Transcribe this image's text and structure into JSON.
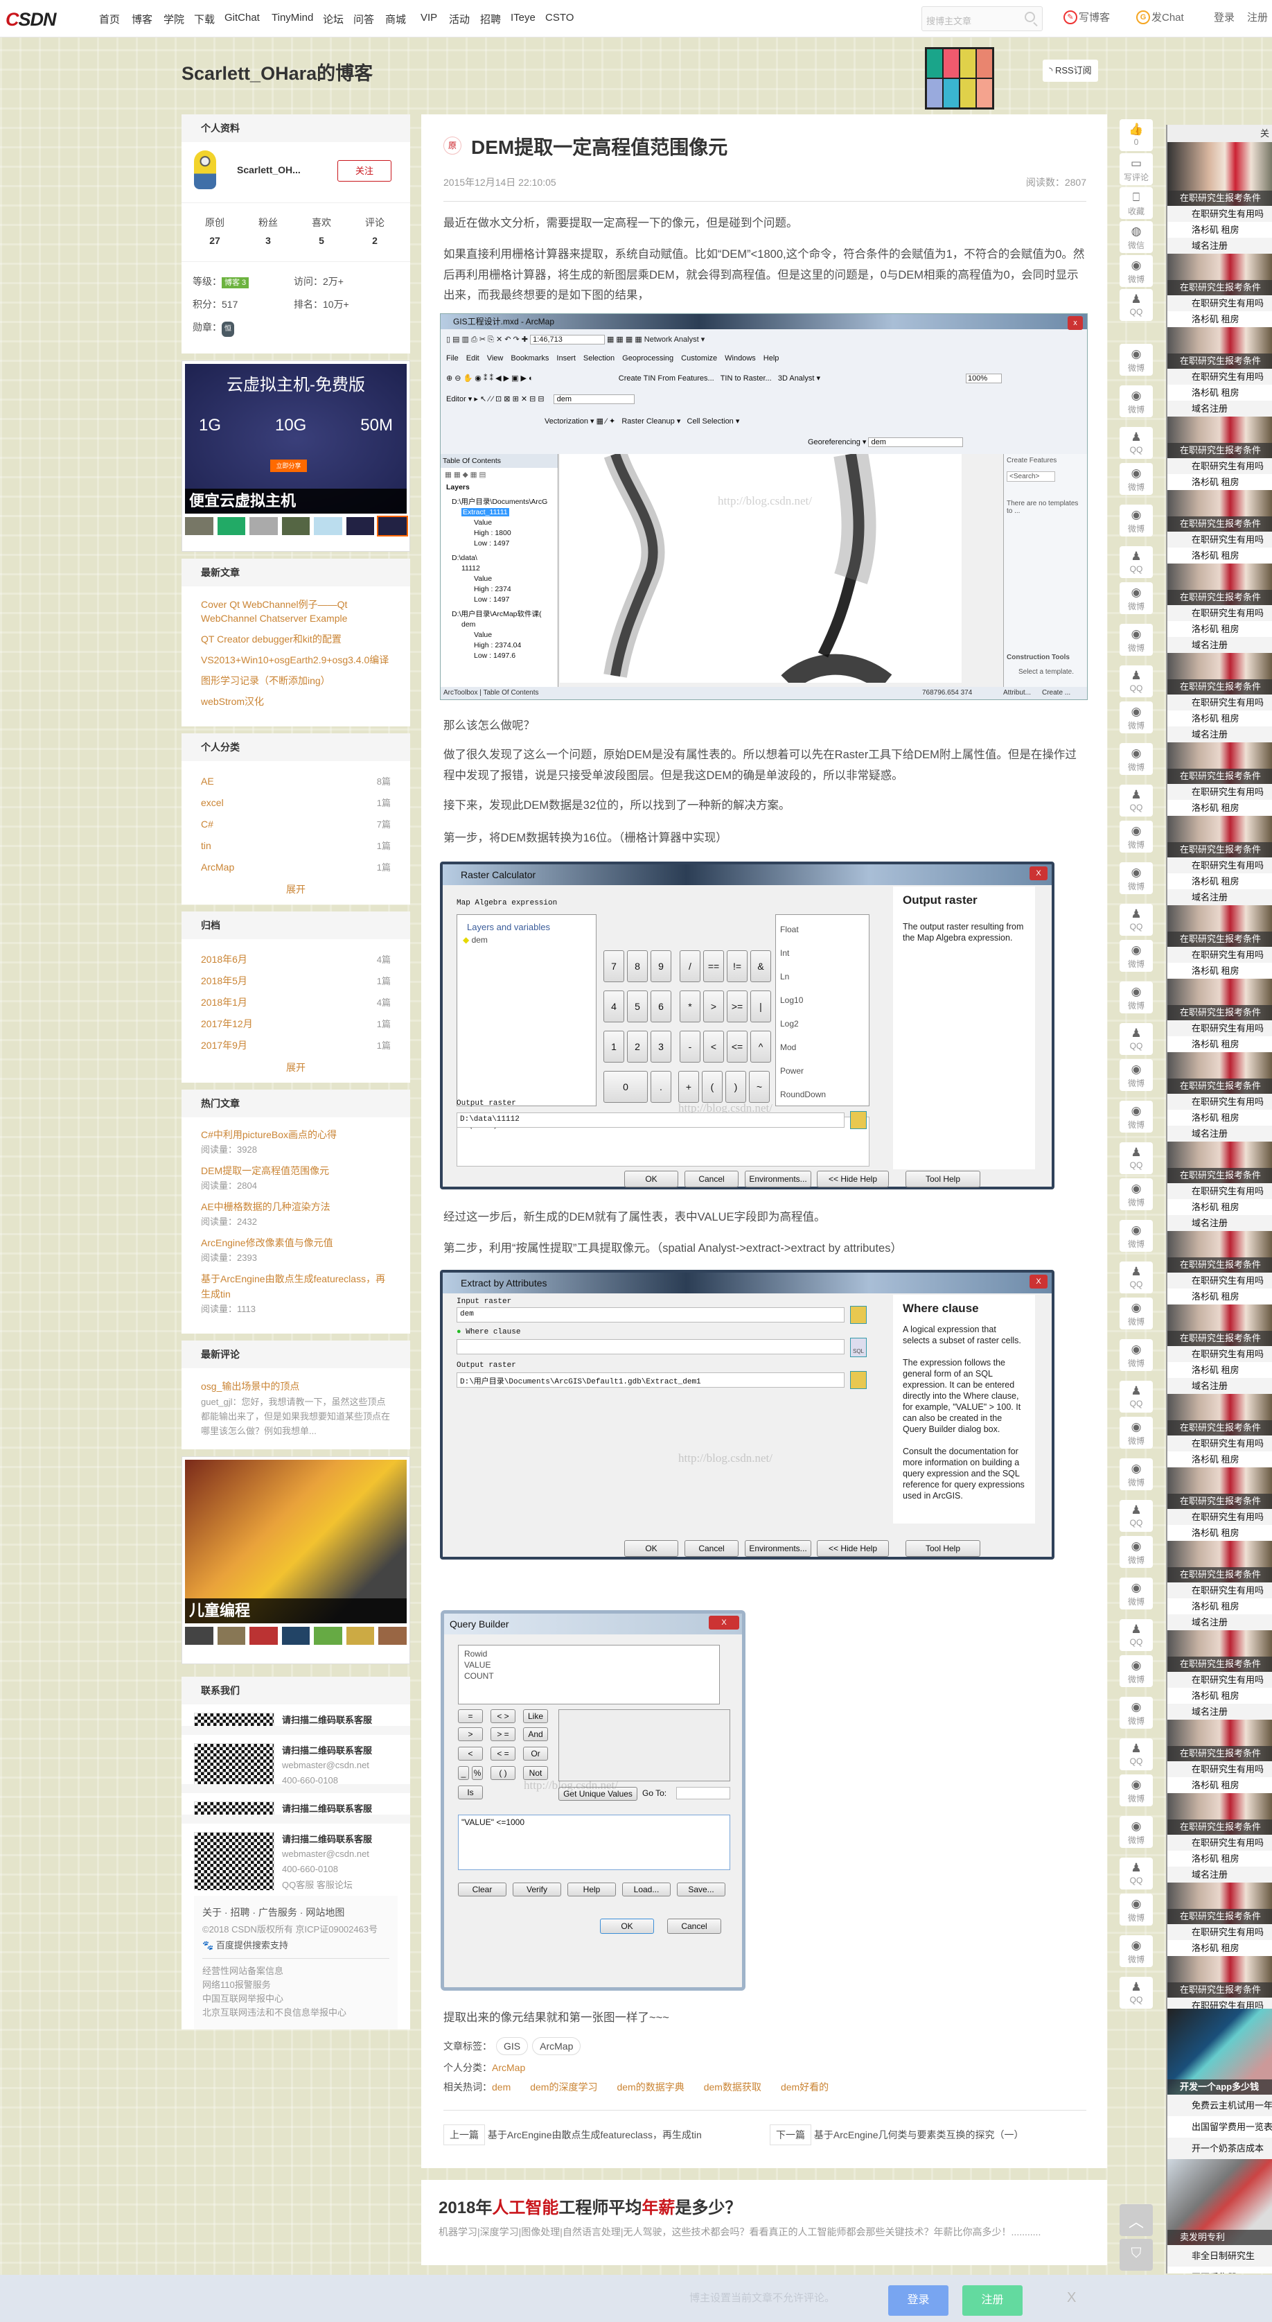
{
  "nav": {
    "logo": "CSDN",
    "items": [
      "首页",
      "博客",
      "学院",
      "下载",
      "GitChat",
      "TinyMind",
      "论坛",
      "问答",
      "商城",
      "VIP",
      "活动",
      "招聘",
      "ITeye",
      "CSTO"
    ],
    "search_placeholder": "搜博主文章",
    "write_blog": "写博客",
    "post_chat": "发Chat",
    "login": "登录",
    "register": "注册"
  },
  "header": {
    "blog_title": "Scarlett_OHara的博客",
    "rss": "RSS订阅"
  },
  "profile": {
    "header": "个人资料",
    "name": "Scarlett_OH...",
    "follow": "关注",
    "stats": [
      {
        "label": "原创",
        "value": "27"
      },
      {
        "label": "粉丝",
        "value": "3"
      },
      {
        "label": "喜欢",
        "value": "5"
      },
      {
        "label": "评论",
        "value": "2"
      }
    ],
    "level_label": "等级：",
    "level_badge": "博客 3",
    "visits": "访问：",
    "visits_val": "2万+",
    "points": "积分：",
    "points_val": "517",
    "rank": "排名：",
    "rank_val": "10万+",
    "medal": "勋章：",
    "medal_icon": "恒"
  },
  "ad1": {
    "title": "云虚拟主机-免费版",
    "specs": [
      "1G",
      "10G",
      "50M"
    ],
    "caption": "便宜云虚拟主机",
    "cta": "立即分享"
  },
  "latest": {
    "header": "最新文章",
    "items": [
      "Cover Qt WebChannel例子——Qt WebChannel Chatserver Example",
      "QT Creator debugger和kit的配置",
      "VS2013+Win10+osgEarth2.9+osg3.4.0编译",
      "图形学习记录（不断添加ing）",
      "webStrom汉化"
    ]
  },
  "categories": {
    "header": "个人分类",
    "items": [
      {
        "name": "AE",
        "count": "8篇"
      },
      {
        "name": "excel",
        "count": "1篇"
      },
      {
        "name": "C#",
        "count": "7篇"
      },
      {
        "name": "tin",
        "count": "1篇"
      },
      {
        "name": "ArcMap",
        "count": "1篇"
      }
    ],
    "more": "展开"
  },
  "archive": {
    "header": "归档",
    "items": [
      {
        "name": "2018年6月",
        "count": "4篇"
      },
      {
        "name": "2018年5月",
        "count": "1篇"
      },
      {
        "name": "2018年1月",
        "count": "4篇"
      },
      {
        "name": "2017年12月",
        "count": "1篇"
      },
      {
        "name": "2017年9月",
        "count": "1篇"
      }
    ],
    "more": "展开"
  },
  "hot": {
    "header": "热门文章",
    "items": [
      {
        "title": "C#中利用pictureBox画点的心得",
        "reads": "阅读量：3928"
      },
      {
        "title": "DEM提取一定高程值范围像元",
        "reads": "阅读量：2804"
      },
      {
        "title": "AE中栅格数据的几种渲染方法",
        "reads": "阅读量：2432"
      },
      {
        "title": "ArcEngine修改像素值与像元值",
        "reads": "阅读量：2393"
      },
      {
        "title": "基于ArcEngine由散点生成featureclass，再生成tin",
        "reads": "阅读量：1113"
      }
    ]
  },
  "comments": {
    "header": "最新评论",
    "items": [
      {
        "title": "osg_输出场景中的顶点",
        "text": "guet_gjl：您好，我想请教一下，虽然这些顶点都能输出来了，但是如果我想要知道某些顶点在哪里该怎么做？例如我想单..."
      }
    ]
  },
  "ad2": {
    "caption": "儿童编程"
  },
  "contact": {
    "header": "联系我们",
    "scan": "请扫描二维码联系客服",
    "email": "webmaster@csdn.net",
    "phone": "400-660-0108",
    "qq": "QQ客服",
    "forum": "客服论坛",
    "footer_links": [
      "关于",
      "招聘",
      "广告服务",
      "网站地图"
    ],
    "copyright": "©2018 CSDN版权所有 京ICP证09002463号",
    "baidu": "百度提供搜索支持",
    "legal": [
      "经营性网站备案信息",
      "网络110报警服务",
      "中国互联网举报中心",
      "北京互联网违法和不良信息举报中心"
    ]
  },
  "article": {
    "badge": "原",
    "title": "DEM提取一定高程值范围像元",
    "date": "2015年12月14日 22:10:05",
    "reads": "阅读数：2807",
    "paragraphs": [
      "最近在做水文分析，需要提取一定高程一下的像元，但是碰到个问题。",
      "如果直接利用栅格计算器来提取，系统自动赋值。比如“DEM”<1800,这个命令，符合条件的会赋值为1，不符合的会赋值为0。然后再利用栅格计算器，将生成的新图层乘DEM，就会得到高程值。但是这里的问题是，0与DEM相乘的高程值为0，会同时显示出来，而我最终想要的是如下图的结果，",
      "那么该怎么做呢？",
      "做了很久发现了这么一个问题，原始DEM是没有属性表的。所以想着可以先在Raster工具下给DEM附上属性值。但是在操作过程中发现了报错，说是只接受单波段图层。但是我这DEM的确是单波段的，所以非常疑惑。",
      "接下来，发现此DEM数据是32位的，所以找到了一种新的解决方案。",
      "第一步，将DEM数据转换为16位。（栅格计算器中实现）",
      "经过这一步后，新生成的DEM就有了属性表，表中VALUE字段即为高程值。",
      "第二步，利用“按属性提取”工具提取像元。（spatial Analyst->extract->extract by attributes）",
      "提取出来的像元结果就和第一张图一样了~~~"
    ],
    "watermark": "http://blog.csdn.net/",
    "arcmap": {
      "title": "GIS工程设计.mxd - ArcMap",
      "scale": "1:46,713",
      "menu": [
        "File",
        "Edit",
        "View",
        "Bookmarks",
        "Insert",
        "Selection",
        "Geoprocessing",
        "Customize",
        "Windows",
        "Help"
      ],
      "toolbar_texts": [
        "Network Analyst ▾",
        "Create TIN From Features...",
        "TIN to Raster...",
        "3D Analyst ▾",
        "Editor ▾",
        "dem",
        "Vectorization ▾",
        "Raster Cleanup ▾",
        "Cell Selection ▾",
        "Georeferencing ▾",
        "dem",
        "100%"
      ],
      "toc_title": "Table Of Contents",
      "layers": "Layers",
      "toc": [
        {
          "t": "D:\\用户目录\\Documents\\ArcG",
          "lvl": 1
        },
        {
          "t": "Extract_11111",
          "lvl": 2,
          "sel": true
        },
        {
          "t": "Value",
          "lvl": 3
        },
        {
          "t": "High : 1800",
          "lvl": 3
        },
        {
          "t": "Low : 1497",
          "lvl": 3
        },
        {
          "t": "D:\\data\\",
          "lvl": 1
        },
        {
          "t": "11112",
          "lvl": 2
        },
        {
          "t": "Value",
          "lvl": 3
        },
        {
          "t": "High : 2374",
          "lvl": 3
        },
        {
          "t": "Low : 1497",
          "lvl": 3
        },
        {
          "t": "D:\\用户目录\\ArcMap软件课(",
          "lvl": 1
        },
        {
          "t": "dem",
          "lvl": 2
        },
        {
          "t": "Value",
          "lvl": 3
        },
        {
          "t": "High : 2374.04",
          "lvl": 3
        },
        {
          "t": "Low : 1497.6",
          "lvl": 3
        }
      ],
      "create_features": "Create Features",
      "search": "<Search>",
      "no_templates": "There are no templates to ...",
      "construction_tools": "Construction Tools",
      "select_template": "Select a template.",
      "tabs": [
        "ArcToolbox",
        "Table Of Contents"
      ],
      "bottom_tabs": [
        "Attribut...",
        "Create ..."
      ],
      "coords": "768796.654  374"
    },
    "raster_calc": {
      "title": "Raster Calculator",
      "expr_label": "Map Algebra expression",
      "layers_label": "Layers and variables",
      "layer": "dem",
      "keys": [
        "7",
        "8",
        "9",
        "/",
        "==",
        "!=",
        "&",
        "4",
        "5",
        "6",
        "*",
        ">",
        ">=",
        "|",
        "1",
        "2",
        "3",
        "-",
        "<",
        "<=",
        "^",
        "0",
        ".",
        "+",
        "(",
        ")",
        "~"
      ],
      "funcs": [
        "Float",
        "Int",
        "Ln",
        "Log10",
        "Log2",
        "Mod",
        "Power",
        "RoundDown"
      ],
      "expression": "Int(\"dem\")",
      "output_label": "Output raster",
      "output": "D:\\data\\11112",
      "help_title": "Output raster",
      "help_text": "The output raster resulting from the Map Algebra expression.",
      "buttons": [
        "OK",
        "Cancel",
        "Environments...",
        "<< Hide Help",
        "Tool Help"
      ]
    },
    "extract": {
      "title": "Extract by Attributes",
      "input_label": "Input raster",
      "input": "dem",
      "where_label": "Where clause",
      "output_label": "Output raster",
      "output": "D:\\用户目录\\Documents\\ArcGIS\\Default1.gdb\\Extract_dem1",
      "help_title": "Where clause",
      "help_paras": [
        "A logical expression that selects a subset of raster cells.",
        "The expression follows the general form of an SQL expression. It can be entered directly into the Where clause, for example, \"VALUE\" > 100. It can also be created in the Query Builder dialog box.",
        "Consult the documentation for more information on building a query expression and the SQL reference for query expressions used in ArcGIS."
      ],
      "buttons": [
        "OK",
        "Cancel",
        "Environments...",
        "<< Hide Help",
        "Tool Help"
      ]
    },
    "query": {
      "title": "Query Builder",
      "fields": [
        "Rowid",
        "VALUE",
        "COUNT"
      ],
      "ops": [
        "=",
        "< >",
        "Like",
        ">",
        "> =",
        "And",
        "<",
        "< =",
        "Or",
        "_",
        "%",
        "( )",
        "Not",
        "Is"
      ],
      "unique": "Get Unique Values",
      "goto": "Go To:",
      "expression": "\"VALUE\" <=1000",
      "buttons": [
        "Clear",
        "Verify",
        "Help",
        "Load...",
        "Save..."
      ],
      "ok": "OK",
      "cancel": "Cancel"
    },
    "tags_label": "文章标签：",
    "tags": [
      "GIS",
      "ArcMap"
    ],
    "category_label": "个人分类：",
    "category": "ArcMap",
    "hotwords_label": "相关热词：",
    "hotwords": [
      "dem",
      "dem的深度学习",
      "dem的数据字典",
      "dem数据获取",
      "dem好看的"
    ],
    "prev_label": "上一篇",
    "prev": "基于ArcEngine由散点生成featureclass，再生成tin",
    "next_label": "下一篇",
    "next": "基于ArcEngine几何类与要素类互换的探究（一）"
  },
  "recommend": {
    "title_parts": [
      {
        "t": "2018年",
        "red": false
      },
      {
        "t": "人工智能",
        "red": true
      },
      {
        "t": "工程师平均",
        "red": false
      },
      {
        "t": "年薪",
        "red": true
      },
      {
        "t": "是多少？",
        "red": false
      }
    ],
    "desc": "机器学习|深度学习|图像处理|自然语言处理|无人驾驶，这些技术都会吗？看看真正的人工智能师都会那些关键技术？年薪比你高多少！..........."
  },
  "toolbar": {
    "items": [
      {
        "icon": "thumbs-up",
        "label": "0"
      },
      {
        "icon": "comment",
        "label": "写评论"
      },
      {
        "icon": "bookmark",
        "label": "收藏"
      },
      {
        "icon": "wechat",
        "label": "微信"
      },
      {
        "icon": "weibo",
        "label": "微博"
      },
      {
        "icon": "qq",
        "label": "QQ"
      }
    ],
    "repeat": [
      {
        "icon": "weibo",
        "label": "微博"
      },
      {
        "icon": "weibo",
        "label": "微博"
      },
      {
        "icon": "qq",
        "label": "QQ"
      }
    ]
  },
  "ads": {
    "close": "关",
    "caption": "在职研究生报考条件",
    "rows": [
      "在职研究生有用吗",
      "洛杉矶 租房",
      "域名注册"
    ],
    "bottom": [
      {
        "caption": "开发一个app多少钱",
        "rows": [
          "免费云主机试用一年",
          "出国留学费用一览表",
          "开一个奶茶店成本"
        ]
      },
      {
        "caption": "卖发明专利",
        "rows": [
          "非全日制研究生",
          "网页采集器",
          "landsat8数据"
        ]
      }
    ]
  },
  "bottom": {
    "notice": "博主设置当前文章不允许评论。",
    "login": "登录",
    "register": "注册",
    "close": "X"
  },
  "colors": {
    "link": "#ca8434",
    "red": "#c9161c",
    "login_btn": "#78a5f1",
    "register_btn": "#63da9f"
  }
}
